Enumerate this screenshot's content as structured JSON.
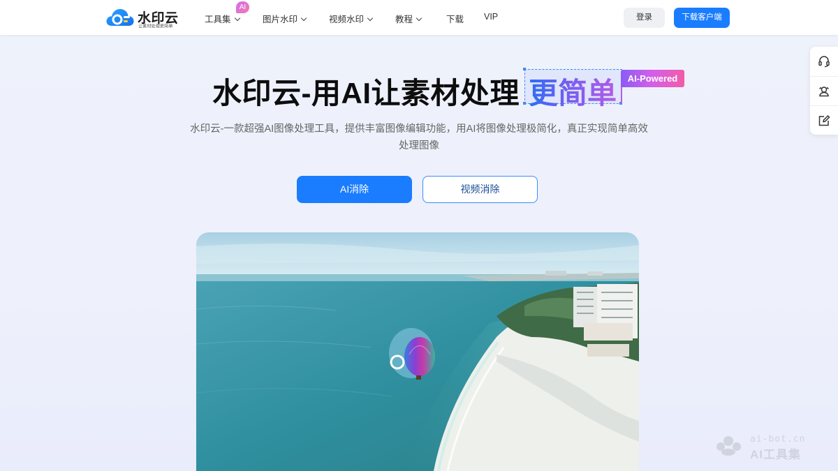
{
  "header": {
    "logo": {
      "name": "水印云",
      "tagline": "让素材处理更简单"
    },
    "nav": [
      {
        "label": "工具集",
        "has_dropdown": true,
        "badge": "AI"
      },
      {
        "label": "图片水印",
        "has_dropdown": true
      },
      {
        "label": "视频水印",
        "has_dropdown": true
      },
      {
        "label": "教程",
        "has_dropdown": true
      },
      {
        "label": "下载",
        "has_dropdown": false
      },
      {
        "label": "VIP",
        "has_dropdown": false
      }
    ],
    "login_label": "登录",
    "download_label": "下载客户端"
  },
  "sidebar": {
    "icons": [
      "headset-icon",
      "user-group-icon",
      "edit-icon"
    ]
  },
  "hero": {
    "title": "水印云-用AI让素材处理",
    "highlight": "更简单",
    "powered_badge": "AI-Powered",
    "subtitle": "水印云-一款超强AI图像处理工具，提供丰富图像编辑功能，用AI将图像处理极简化，真正实现简单高效处理图像",
    "primary_button": "AI消除",
    "secondary_button": "视频消除"
  },
  "showcase": {
    "description": "aerial beach scene with hot-air balloon being erased"
  },
  "watermark": {
    "url": "ai-bot.cn",
    "name": "AI工具集"
  },
  "colors": {
    "accent": "#1a7cff",
    "highlight_gradient": [
      "#2b6ef5",
      "#b35be6"
    ],
    "badge_gradient": [
      "#8a5cf5",
      "#f25ca8"
    ]
  }
}
